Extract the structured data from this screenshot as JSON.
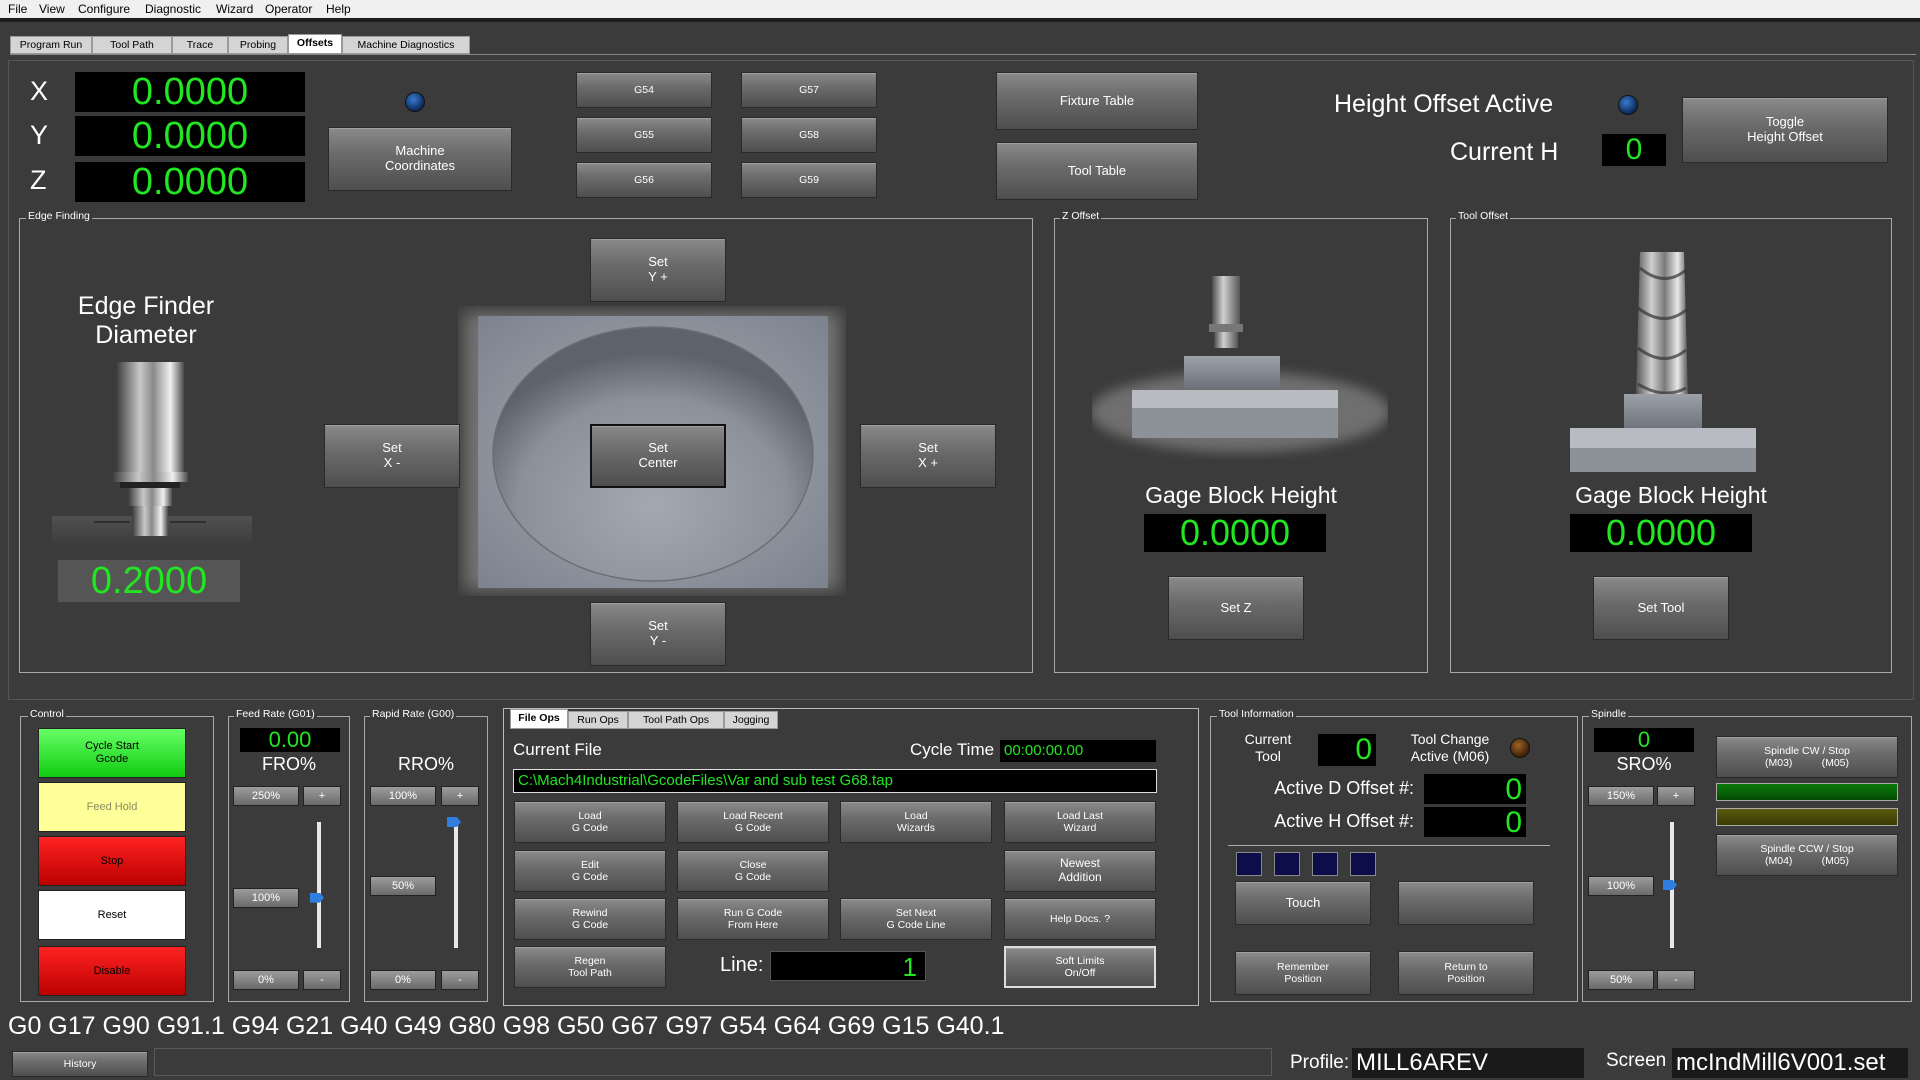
{
  "menu": [
    "File",
    "View",
    "Configure",
    "Diagnostic",
    "Wizard",
    "Operator",
    "Help"
  ],
  "tabs": [
    "Program Run",
    "Tool Path",
    "Trace",
    "Probing",
    "Offsets",
    "Machine Diagnostics"
  ],
  "axes": [
    {
      "label": "X",
      "value": "0.0000"
    },
    {
      "label": "Y",
      "value": "0.0000"
    },
    {
      "label": "Z",
      "value": "0.0000"
    }
  ],
  "machine_coords_label": "Machine\nCoordinates",
  "work_offsets": [
    "G54",
    "G55",
    "G56",
    "G57",
    "G58",
    "G59"
  ],
  "fixture_table": "Fixture Table",
  "tool_table": "Tool Table",
  "height_offset": {
    "title": "Height Offset Active",
    "current_h_label": "Current H",
    "current_h": "0",
    "toggle": "Toggle\nHeight Offset"
  },
  "edge_finding": {
    "frame": "Edge Finding",
    "title": "Edge Finder\nDiameter",
    "value": "0.2000",
    "set_y_plus": "Set\nY +",
    "set_x_minus": "Set\nX -",
    "set_center": "Set\nCenter",
    "set_x_plus": "Set\nX +",
    "set_y_minus": "Set\nY -"
  },
  "z_offset": {
    "frame": "Z Offset",
    "title": "Gage Block Height",
    "value": "0.0000",
    "button": "Set Z"
  },
  "tool_offset": {
    "frame": "Tool Offset",
    "title": "Gage Block Height",
    "value": "0.0000",
    "button": "Set Tool"
  },
  "control": {
    "frame": "Control",
    "cycle_start": "Cycle Start\nGcode",
    "feed_hold": "Feed Hold",
    "stop": "Stop",
    "reset": "Reset",
    "disable": "Disable"
  },
  "feed_rate": {
    "frame": "Feed Rate (G01)",
    "value": "0.00",
    "label": "FRO%",
    "top": "250%",
    "plus": "+",
    "mid": "100%",
    "bottom": "0%",
    "minus": "-",
    "level": 0.4
  },
  "rapid_rate": {
    "frame": "Rapid Rate (G00)",
    "label": "RRO%",
    "top": "100%",
    "plus": "+",
    "mid": "50%",
    "bottom": "0%",
    "minus": "-",
    "level": 1.0
  },
  "file_tabs": [
    "File Ops",
    "Run Ops",
    "Tool Path Ops",
    "Jogging"
  ],
  "file_ops": {
    "current_file_label": "Current File",
    "cycle_time_label": "Cycle Time",
    "cycle_time": "00:00:00.00",
    "path": "C:\\Mach4Industrial\\GcodeFiles\\Var and sub test G68.tap",
    "buttons": [
      "Load\nG Code",
      "Load Recent\nG Code",
      "Load\nWizards",
      "Load Last\nWizard",
      "Edit\nG Code",
      "Close\nG Code",
      "Newest\nAddition",
      "Rewind\nG Code",
      "Run G Code\nFrom Here",
      "Set Next\nG Code Line",
      "Help Docs. ?",
      "Regen\nTool Path",
      "Soft Limits\nOn/Off"
    ],
    "line_label": "Line:",
    "line_value": "1"
  },
  "tool_info": {
    "frame": "Tool Information",
    "current_tool_label": "Current\nTool",
    "current_tool": "0",
    "tool_change_label": "Tool Change\nActive (M06)",
    "d_offset_label": "Active D Offset #:",
    "d_offset": "0",
    "h_offset_label": "Active H Offset #:",
    "h_offset": "0",
    "touch": "Touch",
    "blank": "",
    "remember": "Remember\nPosition",
    "return": "Return to\nPosition"
  },
  "spindle": {
    "frame": "Spindle",
    "value": "0",
    "label": "SRO%",
    "top": "150%",
    "plus": "+",
    "mid": "100%",
    "bottom": "50%",
    "minus": "-",
    "level": 0.5,
    "cw": "Spindle CW / Stop\n(M03)          (M05)",
    "ccw": "Spindle CCW / Stop\n(M04)          (M05)"
  },
  "gcodes": "G0 G17 G90 G91.1 G94 G21 G40 G49 G80 G98 G50 G67 G97 G54 G64 G69 G15 G40.1",
  "history": "History",
  "profile_label": "Profile:",
  "profile": "MILL6AREV",
  "screen_label": "Screen",
  "screen": "mcIndMill6V001.set",
  "colors": {
    "dro_text": "#22e622",
    "cycle_start": "#22dd22",
    "feed_hold": "#ffff99",
    "stop": "#dd0000",
    "reset": "#ffffff",
    "disable": "#dd0000"
  }
}
